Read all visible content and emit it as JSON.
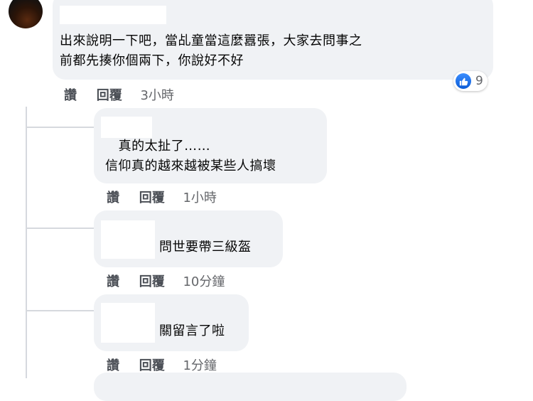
{
  "comment": {
    "text": "出來說明一下吧，當乩童當這麼囂張，大家去問事之\n前都先揍你個兩下，你說好不好",
    "reaction": {
      "icon": "like-icon",
      "count": "9"
    },
    "actions": {
      "like": "讚",
      "reply": "回覆",
      "time": "3小時"
    }
  },
  "replies": [
    {
      "text": "   真的太扯了……\n信仰真的越來越被某些人搞壞",
      "like": "讚",
      "reply": "回覆",
      "time": "1小時"
    },
    {
      "text": "問世要帶三級盔",
      "like": "讚",
      "reply": "回覆",
      "time": "10分鐘"
    },
    {
      "text": "關留言了啦",
      "like": "讚",
      "reply": "回覆",
      "time": "1分鐘"
    }
  ]
}
